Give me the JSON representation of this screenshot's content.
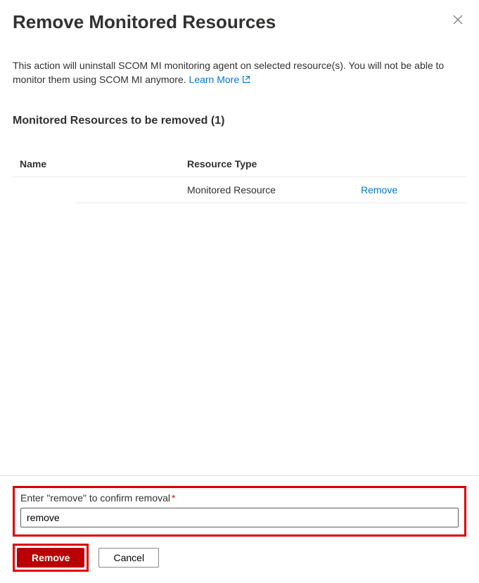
{
  "header": {
    "title": "Remove Monitored Resources"
  },
  "description": {
    "text": "This action will uninstall SCOM MI monitoring agent on selected resource(s). You will not be able to monitor them using SCOM MI anymore. ",
    "learn_more": "Learn More"
  },
  "section": {
    "label": "Monitored Resources to be removed (1)"
  },
  "table": {
    "columns": {
      "name": "Name",
      "type": "Resource Type"
    },
    "rows": [
      {
        "name": "",
        "type": "Monitored Resource",
        "action": "Remove"
      }
    ]
  },
  "confirm": {
    "label": "Enter \"remove\" to confirm removal",
    "required_marker": "*",
    "value": "remove"
  },
  "buttons": {
    "remove": "Remove",
    "cancel": "Cancel"
  }
}
